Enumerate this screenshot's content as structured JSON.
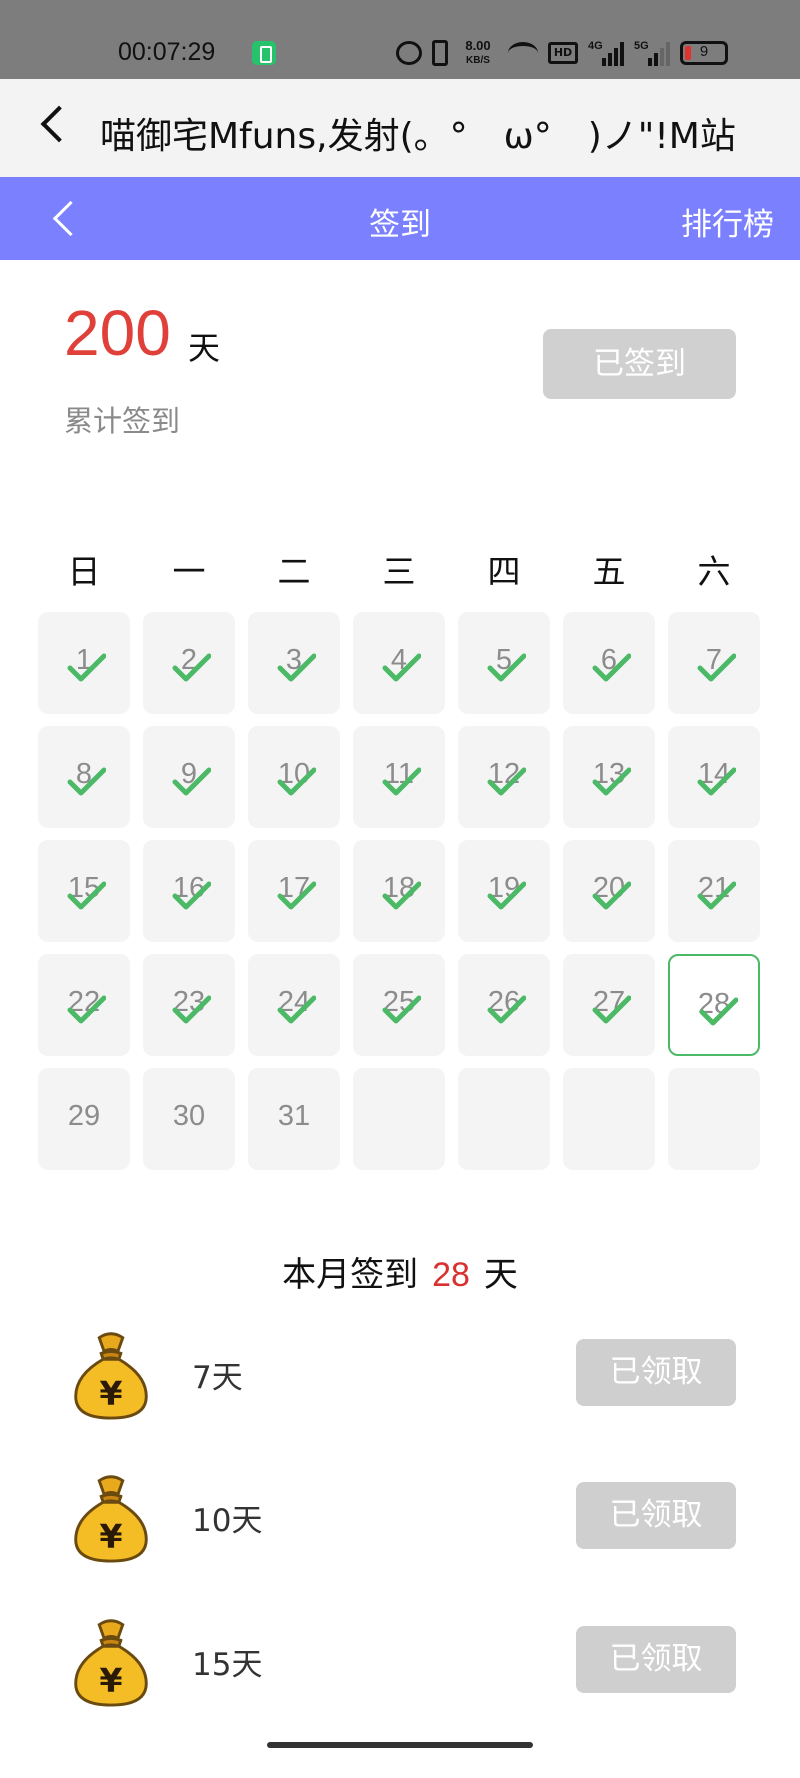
{
  "status_bar": {
    "time": "00:07:29",
    "speed_value": "8.00",
    "speed_unit": "KB/S",
    "hd_label": "HD",
    "signal1_label": "4G",
    "signal2_label": "5G",
    "battery_level": "9"
  },
  "web_bar": {
    "title": "喵御宅Mfuns,发射(。°　ω°　)ノ\"!M站"
  },
  "header": {
    "title": "签到",
    "rank_label": "排行榜",
    "background_color": "#7b80ff"
  },
  "summary": {
    "total_days": "200",
    "total_unit": "天",
    "total_label": "累计签到",
    "sign_button": "已签到"
  },
  "calendar": {
    "weekdays": [
      "日",
      "一",
      "二",
      "三",
      "四",
      "五",
      "六"
    ],
    "days": [
      "1",
      "2",
      "3",
      "4",
      "5",
      "6",
      "7",
      "8",
      "9",
      "10",
      "11",
      "12",
      "13",
      "14",
      "15",
      "16",
      "17",
      "18",
      "19",
      "20",
      "21",
      "22",
      "23",
      "24",
      "25",
      "26",
      "27",
      "28",
      "29",
      "30",
      "31"
    ],
    "signed_through": 28,
    "today": 28,
    "check_color": "#4cb966"
  },
  "month": {
    "prefix": "本月签到",
    "count": "28",
    "suffix": "天"
  },
  "rewards": [
    {
      "label": "7天",
      "button": "已领取",
      "icon": "money-bag-icon"
    },
    {
      "label": "10天",
      "button": "已领取",
      "icon": "money-bag-icon"
    },
    {
      "label": "15天",
      "button": "已领取",
      "icon": "money-bag-icon"
    }
  ]
}
